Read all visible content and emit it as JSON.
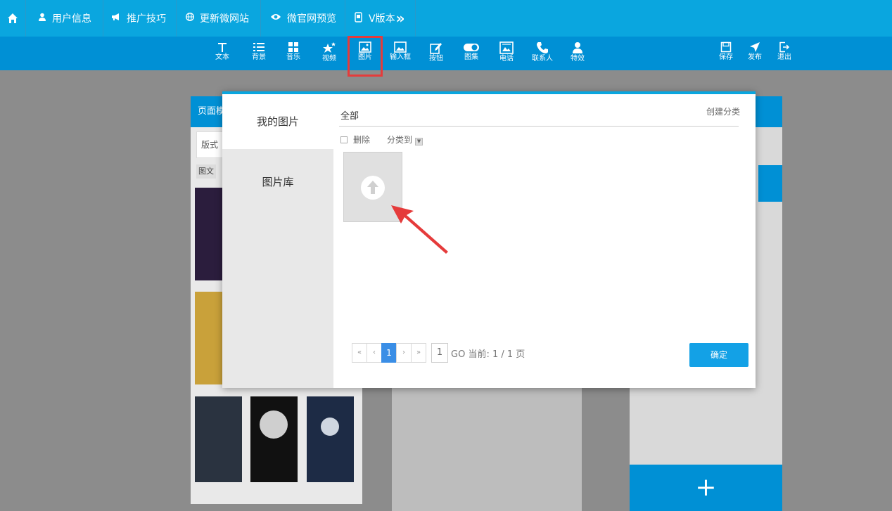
{
  "topnav": {
    "items": [
      {
        "label": "用户信息",
        "icon": "user-icon"
      },
      {
        "label": "推广技巧",
        "icon": "megaphone-icon"
      },
      {
        "label": "更新微网站",
        "icon": "globe-icon"
      },
      {
        "label": "微官网预览",
        "icon": "eye-icon"
      },
      {
        "label": "V版本",
        "icon": "phone-icon",
        "suffix": "»"
      }
    ]
  },
  "toolbar": {
    "items": [
      {
        "label": "文本",
        "icon": "text-icon"
      },
      {
        "label": "背景",
        "icon": "list-icon"
      },
      {
        "label": "音乐",
        "icon": "grid-icon"
      },
      {
        "label": "视频",
        "icon": "star-icon"
      },
      {
        "label": "图片",
        "icon": "image-icon"
      },
      {
        "label": "输入框",
        "icon": "input-icon"
      },
      {
        "label": "按钮",
        "icon": "edit-icon"
      },
      {
        "label": "图集",
        "icon": "toggle-icon"
      },
      {
        "label": "电话",
        "icon": "gallery-icon"
      },
      {
        "label": "联系人",
        "icon": "phone-handset-icon"
      },
      {
        "label": "特效",
        "icon": "person-icon"
      }
    ],
    "right": [
      {
        "label": "保存",
        "icon": "save-icon"
      },
      {
        "label": "发布",
        "icon": "send-icon"
      },
      {
        "label": "退出",
        "icon": "exit-icon"
      }
    ]
  },
  "background": {
    "left_header": "页面模",
    "left_tab": "版式",
    "left_chip": "图文"
  },
  "dialog": {
    "side_items": [
      "我的图片",
      "图片库"
    ],
    "category": "全部",
    "create_category": "创建分类",
    "delete_label": "删除",
    "move_label": "分类到",
    "pager": {
      "first": "«",
      "prev": "‹",
      "current": "1",
      "next": "›",
      "last": "»",
      "input_value": "1",
      "status": "GO 当前: 1 / 1 页"
    },
    "confirm_label": "确定"
  },
  "colors": {
    "nav_bg": "#0aa6df",
    "toolbar_bg": "#0090d5",
    "highlight": "#e53b3b",
    "confirm": "#13a1e6",
    "pager_active": "#3a8ee6"
  }
}
